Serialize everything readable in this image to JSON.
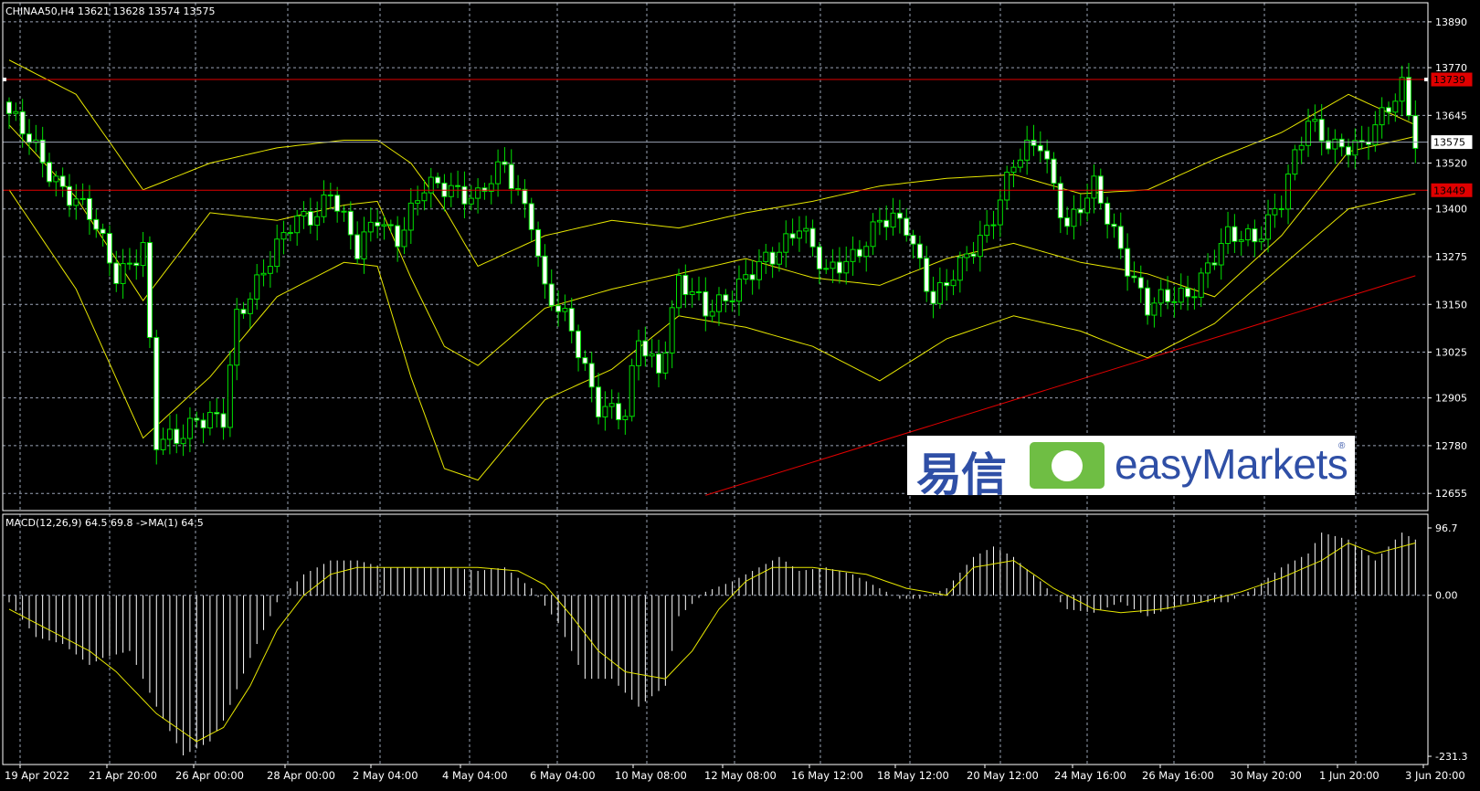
{
  "header": {
    "symbol_line": "CHINAA50,H4  13621 13628 13574 13575",
    "macd_line": "MACD(12,26,9) 64.5 69.8  ->MA(1) 64.5"
  },
  "price_axis_ticks": [
    "13890",
    "13770",
    "13645",
    "13520",
    "13400",
    "13275",
    "13150",
    "13025",
    "12905",
    "12780",
    "12655"
  ],
  "price_axis_values": [
    13890,
    13770,
    13645,
    13520,
    13400,
    13275,
    13150,
    13025,
    12905,
    12780,
    12655
  ],
  "macd_axis_ticks": [
    "96.7",
    "0.00",
    "-231.3"
  ],
  "time_axis_labels": [
    "19 Apr 2022",
    "21 Apr 20:00",
    "26 Apr 00:00",
    "28 Apr 00:00",
    "2 May 04:00",
    "4 May 04:00",
    "6 May 04:00",
    "10 May 08:00",
    "12 May 08:00",
    "16 May 12:00",
    "18 May 12:00",
    "20 May 12:00",
    "24 May 16:00",
    "26 May 16:00",
    "30 May 20:00",
    "1 Jun 20:00",
    "3 Jun 20:00"
  ],
  "price_tags": {
    "resistance": "13739",
    "current": "13575",
    "support": "13449"
  },
  "logo": {
    "cn": "易信",
    "name": "easyMarkets",
    "reg": "®"
  },
  "colors": {
    "background": "#000000",
    "grid": "#9aa3b5",
    "candle": "#00E000",
    "bollinger": "#E6E600",
    "level_line": "#E00000",
    "current_line": "#9aa3b5",
    "macd_hist": "#FFFFFF",
    "macd_signal": "#E6E600",
    "logo_blue": "#2F4FA6",
    "logo_green": "#6FBE44"
  },
  "chart_data": [
    {
      "type": "candlestick",
      "title": "CHINAA50,H4",
      "ylim": [
        12610,
        13940
      ],
      "levels": {
        "resistance": 13739,
        "current": 13575,
        "support": 13449
      },
      "trendline": {
        "from": [
          104,
          12650
        ],
        "to": [
          210,
          13225
        ]
      },
      "bollinger_anchors": {
        "mid": [
          [
            0,
            13620
          ],
          [
            10,
            13430
          ],
          [
            20,
            13160
          ],
          [
            30,
            13390
          ],
          [
            40,
            13370
          ],
          [
            50,
            13410
          ],
          [
            55,
            13420
          ],
          [
            60,
            13220
          ],
          [
            65,
            13040
          ],
          [
            70,
            12990
          ],
          [
            80,
            13140
          ],
          [
            90,
            13190
          ],
          [
            100,
            13230
          ],
          [
            110,
            13270
          ],
          [
            120,
            13220
          ],
          [
            130,
            13200
          ],
          [
            140,
            13270
          ],
          [
            150,
            13310
          ],
          [
            160,
            13260
          ],
          [
            170,
            13230
          ],
          [
            180,
            13170
          ],
          [
            190,
            13330
          ],
          [
            200,
            13550
          ],
          [
            210,
            13590
          ]
        ],
        "upper": [
          [
            0,
            13790
          ],
          [
            10,
            13700
          ],
          [
            20,
            13450
          ],
          [
            30,
            13520
          ],
          [
            40,
            13560
          ],
          [
            50,
            13580
          ],
          [
            55,
            13580
          ],
          [
            60,
            13520
          ],
          [
            65,
            13400
          ],
          [
            70,
            13250
          ],
          [
            80,
            13330
          ],
          [
            90,
            13370
          ],
          [
            100,
            13350
          ],
          [
            110,
            13390
          ],
          [
            120,
            13420
          ],
          [
            130,
            13460
          ],
          [
            140,
            13480
          ],
          [
            150,
            13490
          ],
          [
            160,
            13440
          ],
          [
            170,
            13450
          ],
          [
            180,
            13530
          ],
          [
            190,
            13600
          ],
          [
            200,
            13700
          ],
          [
            210,
            13620
          ]
        ],
        "lower": [
          [
            0,
            13450
          ],
          [
            10,
            13190
          ],
          [
            20,
            12800
          ],
          [
            30,
            12960
          ],
          [
            40,
            13170
          ],
          [
            50,
            13260
          ],
          [
            55,
            13250
          ],
          [
            60,
            12960
          ],
          [
            65,
            12720
          ],
          [
            70,
            12690
          ],
          [
            80,
            12900
          ],
          [
            90,
            12980
          ],
          [
            100,
            13120
          ],
          [
            110,
            13090
          ],
          [
            120,
            13040
          ],
          [
            130,
            12950
          ],
          [
            140,
            13060
          ],
          [
            150,
            13120
          ],
          [
            160,
            13080
          ],
          [
            170,
            13010
          ],
          [
            180,
            13100
          ],
          [
            190,
            13250
          ],
          [
            200,
            13400
          ],
          [
            210,
            13440
          ]
        ]
      },
      "candles": {
        "description": "H4 OHLC series generated from close anchors",
        "close_anchors": [
          [
            0,
            13650
          ],
          [
            6,
            13500
          ],
          [
            12,
            13380
          ],
          [
            16,
            13230
          ],
          [
            20,
            13300
          ],
          [
            22,
            12780
          ],
          [
            25,
            12800
          ],
          [
            28,
            12860
          ],
          [
            32,
            12840
          ],
          [
            34,
            13110
          ],
          [
            38,
            13250
          ],
          [
            42,
            13350
          ],
          [
            46,
            13390
          ],
          [
            48,
            13460
          ],
          [
            52,
            13280
          ],
          [
            55,
            13380
          ],
          [
            58,
            13330
          ],
          [
            62,
            13450
          ],
          [
            66,
            13460
          ],
          [
            70,
            13430
          ],
          [
            74,
            13510
          ],
          [
            78,
            13380
          ],
          [
            80,
            13180
          ],
          [
            84,
            13080
          ],
          [
            88,
            12890
          ],
          [
            92,
            12850
          ],
          [
            94,
            13060
          ],
          [
            97,
            12980
          ],
          [
            100,
            13210
          ],
          [
            104,
            13130
          ],
          [
            108,
            13190
          ],
          [
            114,
            13270
          ],
          [
            118,
            13370
          ],
          [
            122,
            13220
          ],
          [
            126,
            13280
          ],
          [
            130,
            13370
          ],
          [
            134,
            13350
          ],
          [
            138,
            13170
          ],
          [
            142,
            13240
          ],
          [
            146,
            13350
          ],
          [
            150,
            13520
          ],
          [
            154,
            13570
          ],
          [
            158,
            13360
          ],
          [
            162,
            13450
          ],
          [
            166,
            13300
          ],
          [
            170,
            13140
          ],
          [
            176,
            13180
          ],
          [
            182,
            13320
          ],
          [
            186,
            13330
          ],
          [
            190,
            13420
          ],
          [
            194,
            13630
          ],
          [
            198,
            13570
          ],
          [
            202,
            13550
          ],
          [
            206,
            13680
          ],
          [
            208,
            13730
          ],
          [
            210,
            13575
          ]
        ]
      }
    },
    {
      "type": "bar",
      "title": "MACD(12,26,9)",
      "ylim": [
        -231.3,
        96.7
      ],
      "series_anchors": {
        "histogram": [
          [
            0,
            -10
          ],
          [
            4,
            -60
          ],
          [
            8,
            -70
          ],
          [
            12,
            -100
          ],
          [
            14,
            -90
          ],
          [
            18,
            -80
          ],
          [
            22,
            -160
          ],
          [
            26,
            -230
          ],
          [
            30,
            -210
          ],
          [
            32,
            -180
          ],
          [
            36,
            -90
          ],
          [
            40,
            -10
          ],
          [
            44,
            30
          ],
          [
            48,
            50
          ],
          [
            52,
            50
          ],
          [
            56,
            40
          ],
          [
            60,
            40
          ],
          [
            66,
            40
          ],
          [
            70,
            35
          ],
          [
            74,
            40
          ],
          [
            78,
            10
          ],
          [
            82,
            -40
          ],
          [
            86,
            -120
          ],
          [
            90,
            -120
          ],
          [
            94,
            -160
          ],
          [
            98,
            -130
          ],
          [
            100,
            -30
          ],
          [
            104,
            5
          ],
          [
            108,
            20
          ],
          [
            112,
            40
          ],
          [
            115,
            55
          ],
          [
            118,
            35
          ],
          [
            122,
            40
          ],
          [
            126,
            30
          ],
          [
            130,
            10
          ],
          [
            133,
            -5
          ],
          [
            136,
            -5
          ],
          [
            140,
            10
          ],
          [
            144,
            55
          ],
          [
            147,
            70
          ],
          [
            150,
            55
          ],
          [
            154,
            20
          ],
          [
            158,
            -20
          ],
          [
            162,
            -25
          ],
          [
            166,
            -10
          ],
          [
            170,
            -30
          ],
          [
            176,
            -10
          ],
          [
            182,
            -10
          ],
          [
            186,
            10
          ],
          [
            190,
            40
          ],
          [
            194,
            60
          ],
          [
            196,
            90
          ],
          [
            200,
            80
          ],
          [
            204,
            50
          ],
          [
            206,
            70
          ],
          [
            208,
            90
          ],
          [
            210,
            80
          ]
        ],
        "signal": [
          [
            0,
            -20
          ],
          [
            6,
            -50
          ],
          [
            12,
            -80
          ],
          [
            16,
            -110
          ],
          [
            22,
            -170
          ],
          [
            28,
            -210
          ],
          [
            32,
            -190
          ],
          [
            36,
            -130
          ],
          [
            40,
            -50
          ],
          [
            44,
            0
          ],
          [
            48,
            30
          ],
          [
            52,
            40
          ],
          [
            58,
            40
          ],
          [
            64,
            40
          ],
          [
            70,
            40
          ],
          [
            76,
            35
          ],
          [
            80,
            15
          ],
          [
            84,
            -30
          ],
          [
            88,
            -80
          ],
          [
            92,
            -110
          ],
          [
            98,
            -120
          ],
          [
            102,
            -80
          ],
          [
            106,
            -20
          ],
          [
            110,
            20
          ],
          [
            114,
            40
          ],
          [
            120,
            40
          ],
          [
            128,
            30
          ],
          [
            134,
            10
          ],
          [
            140,
            0
          ],
          [
            144,
            40
          ],
          [
            150,
            50
          ],
          [
            156,
            10
          ],
          [
            162,
            -20
          ],
          [
            166,
            -25
          ],
          [
            172,
            -20
          ],
          [
            178,
            -10
          ],
          [
            184,
            5
          ],
          [
            190,
            25
          ],
          [
            196,
            50
          ],
          [
            200,
            75
          ],
          [
            204,
            60
          ],
          [
            208,
            70
          ],
          [
            210,
            75
          ]
        ]
      }
    }
  ]
}
